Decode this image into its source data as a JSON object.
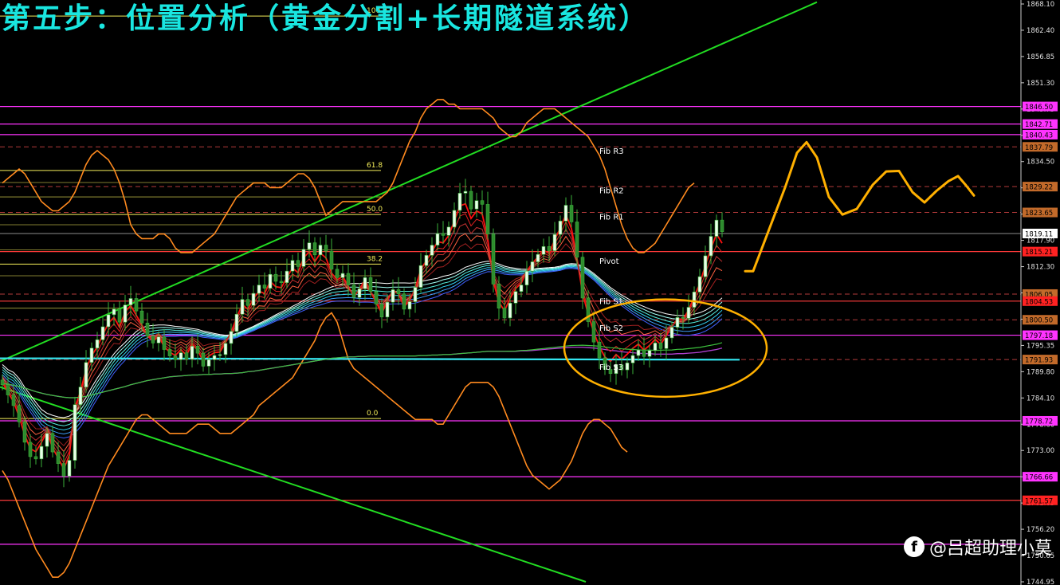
{
  "title": "第五步：位置分析（黄金分割+长期隧道系统）",
  "watermark": {
    "icon": "f-logo-icon",
    "text": "@吕超助理小莫"
  },
  "colors": {
    "background": "#000000",
    "title": "#19e6e0",
    "trendline": "#22dd22",
    "bollinger": "#ff8a1f",
    "projection": "#ffb000",
    "magenta_level": "#ff33ff",
    "red_level": "#ff3a3a",
    "fib_line": "#f5ef5a",
    "tunnel_cyan": "#33e6f0",
    "candle_up": "#e8ffe8",
    "candle_down": "#2e8b2e",
    "axis_text": "#e0e0e0"
  },
  "chart_data": {
    "type": "candlestick",
    "y_axis": {
      "ylim": [
        1744.0,
        1868.6
      ],
      "tick_labels": [
        "1868.10",
        "1862.40",
        "1856.85",
        "1851.30",
        "1845.75",
        "1840.20",
        "1834.50",
        "1829.00",
        "1823.45",
        "1817.90",
        "1812.30",
        "1806.75",
        "1801.20",
        "1795.35",
        "1789.80",
        "1784.10",
        "1778.60",
        "1773.00",
        "1767.30",
        "1761.65",
        "1756.20",
        "1750.65",
        "1744.95"
      ]
    },
    "price_tags": [
      {
        "label": "1846.50",
        "value": 1846.5,
        "color": "#ff33ff",
        "text_color": "#000000"
      },
      {
        "label": "1842.71",
        "value": 1842.71,
        "color": "#ff33ff",
        "text_color": "#000000"
      },
      {
        "label": "1840.43",
        "value": 1840.43,
        "color": "#ff33ff",
        "text_color": "#000000"
      },
      {
        "label": "1837.79",
        "value": 1837.79,
        "color": "#c26a2a",
        "text_color": "#000000"
      },
      {
        "label": "1829.22",
        "value": 1829.22,
        "color": "#c26a2a",
        "text_color": "#000000"
      },
      {
        "label": "1823.65",
        "value": 1823.65,
        "color": "#c26a2a",
        "text_color": "#000000"
      },
      {
        "label": "1819.11",
        "value": 1819.11,
        "color": "#ffffff",
        "text_color": "#000000"
      },
      {
        "label": "1815.21",
        "value": 1815.21,
        "color": "#ff2222",
        "text_color": "#000000"
      },
      {
        "label": "1806.05",
        "value": 1806.05,
        "color": "#c26a2a",
        "text_color": "#000000"
      },
      {
        "label": "1804.53",
        "value": 1804.53,
        "color": "#ff2222",
        "text_color": "#000000"
      },
      {
        "label": "1800.50",
        "value": 1800.5,
        "color": "#c26a2a",
        "text_color": "#000000"
      },
      {
        "label": "1797.18",
        "value": 1797.18,
        "color": "#ff33ff",
        "text_color": "#000000"
      },
      {
        "label": "1791.93",
        "value": 1791.93,
        "color": "#c26a2a",
        "text_color": "#000000"
      },
      {
        "label": "1778.72",
        "value": 1778.72,
        "color": "#ff33ff",
        "text_color": "#000000"
      },
      {
        "label": "1766.66",
        "value": 1766.66,
        "color": "#ff33ff",
        "text_color": "#000000"
      },
      {
        "label": "1761.57",
        "value": 1761.57,
        "color": "#ff2222",
        "text_color": "#000000"
      }
    ],
    "magenta_levels": [
      1846.5,
      1842.71,
      1840.43,
      1797.18,
      1778.72,
      1766.66,
      1752.1
    ],
    "dashed_levels": [
      1837.79,
      1829.22,
      1823.65,
      1806.05,
      1800.5,
      1791.93
    ],
    "red_solid_levels": [
      1815.21,
      1804.53,
      1761.57
    ],
    "white_level": 1819.11,
    "pivot_labels": [
      {
        "label": "Fib R3",
        "value": 1837.0
      },
      {
        "label": "Fib R2",
        "value": 1828.5
      },
      {
        "label": "Fib R1",
        "value": 1822.8
      },
      {
        "label": "Pivot",
        "value": 1813.3
      },
      {
        "label": "Fib S1",
        "value": 1804.6
      },
      {
        "label": "Fib S2",
        "value": 1798.8
      },
      {
        "label": "Fib S3",
        "value": 1790.4
      }
    ],
    "fibonacci": [
      {
        "label": "100.0",
        "value": 1866.0
      },
      {
        "label": "61.8",
        "value": 1832.7
      },
      {
        "label": "50.0",
        "value": 1823.2
      },
      {
        "label": "38.2",
        "value": 1812.5
      },
      {
        "label": "0.0",
        "value": 1779.2
      }
    ],
    "fib_extra_levels": [
      1830.1,
      1827.0,
      1821.0,
      1815.6,
      1810.0,
      1803.0
    ],
    "closes": [
      1786.5,
      1784.3,
      1782.0,
      1778.5,
      1774.1,
      1771.0,
      1770.5,
      1773.2,
      1776.0,
      1772.0,
      1769.5,
      1766.8,
      1770.2,
      1782.2,
      1786.0,
      1791.3,
      1794.4,
      1796.2,
      1799.0,
      1801.6,
      1802.8,
      1800.0,
      1803.7,
      1805.1,
      1802.4,
      1799.8,
      1797.0,
      1795.5,
      1796.8,
      1794.1,
      1792.7,
      1791.9,
      1793.4,
      1792.0,
      1794.8,
      1793.3,
      1790.5,
      1791.9,
      1792.8,
      1793.0,
      1795.4,
      1798.0,
      1801.7,
      1804.9,
      1803.6,
      1806.2,
      1808.0,
      1807.3,
      1810.3,
      1808.8,
      1808.5,
      1811.0,
      1813.3,
      1812.0,
      1815.7,
      1817.1,
      1814.5,
      1816.6,
      1815.3,
      1811.4,
      1809.6,
      1810.5,
      1808.0,
      1805.3,
      1807.2,
      1809.6,
      1806.6,
      1803.9,
      1801.1,
      1804.3,
      1807.0,
      1806.1,
      1802.8,
      1804.4,
      1807.5,
      1812.2,
      1814.4,
      1816.6,
      1819.1,
      1818.7,
      1820.5,
      1824.1,
      1827.8,
      1828.2,
      1824.4,
      1826.2,
      1825.4,
      1819.0,
      1808.2,
      1803.0,
      1800.9,
      1804.1,
      1806.6,
      1808.0,
      1811.0,
      1813.0,
      1814.6,
      1816.3,
      1815.4,
      1818.9,
      1821.8,
      1825.2,
      1821.6,
      1814.0,
      1805.2,
      1800.1,
      1795.7,
      1792.3,
      1789.8,
      1788.9,
      1790.8,
      1789.7,
      1791.2,
      1792.8,
      1794.0,
      1792.6,
      1793.9,
      1795.5,
      1794.3,
      1796.6,
      1798.9,
      1801.0,
      1800.8,
      1803.2,
      1806.5,
      1809.8,
      1814.3,
      1818.5,
      1822.0,
      1819.5
    ],
    "ma_fast": [
      1789.5,
      1788.3,
      1787.6,
      1786.2,
      1784.2,
      1782.5,
      1780.8,
      1779.2,
      1778.3,
      1777.8,
      1777.4,
      1777.2,
      1777.5,
      1778.3,
      1779.7,
      1781.5,
      1783.7,
      1785.7,
      1787.5,
      1789.4,
      1791.1,
      1792.5,
      1793.7,
      1795.0,
      1796.2,
      1797.1,
      1797.6,
      1797.8,
      1798.0,
      1798.1,
      1798.1,
      1798.0,
      1798.0,
      1797.9,
      1797.8,
      1797.7,
      1797.4,
      1797.2,
      1797.0,
      1796.8,
      1796.7,
      1796.8,
      1797.1,
      1797.6,
      1798.1,
      1798.6,
      1799.2,
      1799.7,
      1800.3,
      1800.9,
      1801.4,
      1801.9,
      1802.5,
      1803.0,
      1803.6,
      1804.2,
      1804.7,
      1805.1,
      1805.6,
      1806.0,
      1806.2,
      1806.3,
      1806.4,
      1806.4,
      1806.3,
      1806.4,
      1806.4,
      1806.3,
      1806.2,
      1806.1,
      1806.2,
      1806.2,
      1806.2,
      1806.2,
      1806.3,
      1806.6,
      1806.9,
      1807.2,
      1807.5,
      1808.0,
      1808.3,
      1808.8,
      1809.5,
      1810.3,
      1810.8,
      1811.3,
      1811.7,
      1812.0,
      1811.9,
      1811.6,
      1811.2,
      1811.0,
      1810.9,
      1810.8,
      1810.8,
      1810.9,
      1811.1,
      1811.2,
      1811.3,
      1811.4,
      1811.6,
      1812.0,
      1812.1,
      1812.0,
      1811.5,
      1810.7,
      1809.8,
      1808.7,
      1807.6,
      1806.5,
      1805.6,
      1804.7,
      1803.9,
      1803.1,
      1802.4,
      1801.8,
      1801.2,
      1800.7,
      1800.3,
      1799.9,
      1799.6,
      1799.4,
      1799.3,
      1799.3,
      1799.5,
      1799.8,
      1800.3,
      1801.0,
      1801.9,
      1803.0
    ],
    "ma_slow": [
      1786.8,
      1786.6,
      1786.4,
      1786.1,
      1785.8,
      1785.4,
      1785.0,
      1784.7,
      1784.4,
      1784.2,
      1784.0,
      1783.8,
      1783.7,
      1783.7,
      1783.8,
      1784.0,
      1784.3,
      1784.6,
      1784.9,
      1785.2,
      1785.5,
      1785.8,
      1786.1,
      1786.5,
      1786.8,
      1787.1,
      1787.4,
      1787.6,
      1787.8,
      1788.0,
      1788.2,
      1788.3,
      1788.4,
      1788.5,
      1788.6,
      1788.6,
      1788.7,
      1788.7,
      1788.8,
      1788.8,
      1788.9,
      1788.9,
      1789.0,
      1789.1,
      1789.3,
      1789.4,
      1789.6,
      1789.8,
      1790.0,
      1790.2,
      1790.4,
      1790.6,
      1790.8,
      1791.0,
      1791.2,
      1791.4,
      1791.6,
      1791.8,
      1792.0,
      1792.2,
      1792.3,
      1792.4,
      1792.5,
      1792.5,
      1792.6,
      1792.6,
      1792.7,
      1792.7,
      1792.7,
      1792.7,
      1792.7,
      1792.7,
      1792.7,
      1792.7,
      1792.7,
      1792.8,
      1792.8,
      1792.9,
      1792.9,
      1793.0,
      1793.0,
      1793.1,
      1793.2,
      1793.3,
      1793.4,
      1793.5,
      1793.6,
      1793.7,
      1793.7,
      1793.7,
      1793.7,
      1793.7,
      1793.7,
      1793.8,
      1793.8,
      1793.9,
      1794.0,
      1794.1,
      1794.2,
      1794.3,
      1794.4,
      1794.5,
      1794.6,
      1794.6,
      1794.6,
      1794.5,
      1794.4,
      1794.3,
      1794.1,
      1793.9,
      1793.8,
      1793.6,
      1793.5,
      1793.4,
      1793.3,
      1793.2,
      1793.2,
      1793.1,
      1793.1,
      1793.1,
      1793.1,
      1793.2,
      1793.2,
      1793.3,
      1793.4,
      1793.5,
      1793.7,
      1793.9,
      1794.1,
      1794.4
    ],
    "bollinger_upper": [
      1830,
      1831,
      1832,
      1833,
      1832,
      1830,
      1828,
      1826,
      1825,
      1824,
      1824,
      1825,
      1826,
      1828,
      1831,
      1834,
      1836,
      1837,
      1836,
      1835,
      1833,
      1830,
      1826,
      1821,
      1819,
      1818,
      1818,
      1818,
      1819,
      1819,
      1818,
      1816,
      1815,
      1815,
      1815,
      1816,
      1817,
      1818,
      1819,
      1821,
      1823,
      1825,
      1827,
      1828,
      1829,
      1830,
      1830,
      1830,
      1829,
      1829,
      1829,
      1830,
      1831,
      1832,
      1832,
      1831,
      1829,
      1826,
      1823,
      1824,
      1825,
      1826,
      1826,
      1826,
      1826,
      1826,
      1826,
      1826,
      1827,
      1828,
      1830,
      1833,
      1836,
      1839,
      1841,
      1844,
      1846,
      1847,
      1848,
      1848,
      1847,
      1847,
      1846,
      1846,
      1846,
      1846,
      1846,
      1845,
      1844,
      1842,
      1841,
      1840,
      1840,
      1841,
      1843,
      1844,
      1845,
      1846,
      1846,
      1846,
      1845,
      1844,
      1843,
      1842,
      1841,
      1840,
      1838,
      1836,
      1833,
      1829,
      1825,
      1821,
      1818,
      1816,
      1815,
      1815,
      1816,
      1817,
      1819,
      1821,
      1823,
      1825,
      1827,
      1829,
      1830
    ],
    "bollinger_lower": [
      1768,
      1766,
      1763,
      1760,
      1757,
      1754,
      1751,
      1749,
      1747,
      1745,
      1745,
      1746,
      1748,
      1751,
      1754,
      1757,
      1760,
      1763,
      1766,
      1769,
      1771,
      1773,
      1775,
      1777,
      1779,
      1780,
      1780,
      1779,
      1778,
      1777,
      1776,
      1776,
      1776,
      1776,
      1777,
      1778,
      1778,
      1778,
      1777,
      1776,
      1776,
      1776,
      1777,
      1778,
      1779,
      1780,
      1782,
      1783,
      1784,
      1785,
      1786,
      1787,
      1788,
      1790,
      1792,
      1794,
      1796,
      1799,
      1801,
      1802,
      1800,
      1796,
      1792,
      1790,
      1789,
      1788,
      1787,
      1786,
      1785,
      1784,
      1783,
      1782,
      1781,
      1780,
      1779,
      1779,
      1779,
      1779,
      1778,
      1778,
      1780,
      1782,
      1784,
      1786,
      1787,
      1787,
      1787,
      1787,
      1786,
      1784,
      1781,
      1778,
      1775,
      1772,
      1769,
      1767,
      1766,
      1765,
      1764,
      1765,
      1766,
      1768,
      1770,
      1773,
      1776,
      1778,
      1779,
      1779,
      1778,
      1777,
      1775,
      1773,
      1772
    ],
    "trendlines": [
      {
        "x0": 0,
        "v0": 1791.5,
        "x1": 1025,
        "v1": 1869.0
      },
      {
        "x0": 0,
        "v0": 1786.0,
        "x1": 735,
        "v1": 1744.0
      }
    ],
    "projection": [
      [
        935,
        1811.0
      ],
      [
        945,
        1811.0
      ],
      [
        965,
        1820.0
      ],
      [
        985,
        1829.0
      ],
      [
        1000,
        1836.5
      ],
      [
        1012,
        1838.8
      ],
      [
        1025,
        1835.5
      ],
      [
        1040,
        1827.0
      ],
      [
        1057,
        1823.2
      ],
      [
        1075,
        1824.4
      ],
      [
        1095,
        1829.6
      ],
      [
        1112,
        1832.5
      ],
      [
        1128,
        1832.6
      ],
      [
        1145,
        1828.0
      ],
      [
        1160,
        1825.8
      ],
      [
        1175,
        1828.3
      ],
      [
        1190,
        1830.4
      ],
      [
        1202,
        1831.5
      ],
      [
        1212,
        1829.5
      ],
      [
        1222,
        1827.3
      ]
    ],
    "ellipse": {
      "cx": 835,
      "cy": 1794.4,
      "rx": 127,
      "ry": 10.5
    }
  }
}
